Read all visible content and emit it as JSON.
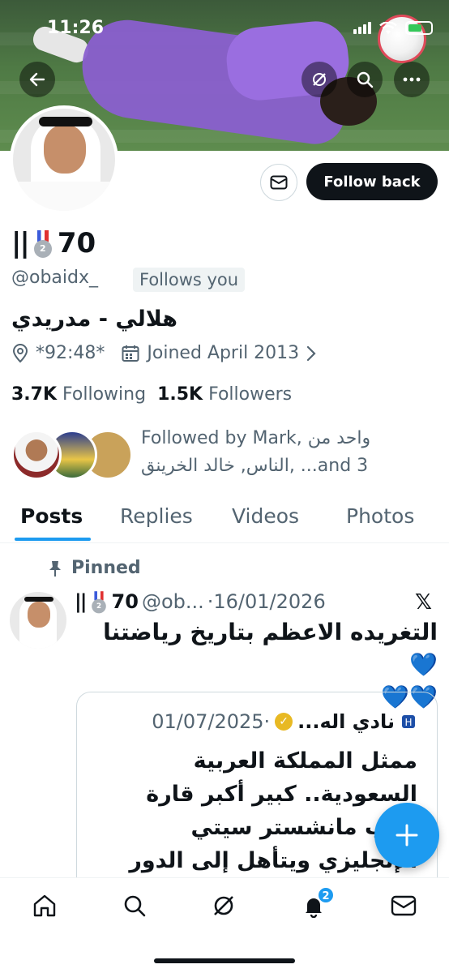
{
  "status_bar": {
    "time": "11:26"
  },
  "profile": {
    "display_name": "70",
    "handle": "@obaidx_",
    "follows_you": "Follows you",
    "bio": "هلالي - مدريدي",
    "location": "*92:48*",
    "joined": "Joined April 2013",
    "following_count": "3.7K",
    "following_label": "Following",
    "followers_count": "1.5K",
    "followers_label": "Followers",
    "followed_by_line1": "Followed by Mark, واحد من",
    "followed_by_line2": "الناس, خالد الخرينق, ...and 3"
  },
  "actions": {
    "follow_back": "Follow back"
  },
  "tabs": [
    {
      "label": "Posts",
      "active": true
    },
    {
      "label": "Replies",
      "active": false
    },
    {
      "label": "Videos",
      "active": false
    },
    {
      "label": "Photos",
      "active": false
    }
  ],
  "post": {
    "pinned_label": "Pinned",
    "author_name": "70",
    "author_handle": "@ob...",
    "date": "·16/01/2026",
    "text_line1": "التغريده الاعظم بتاريخ رياضتنا 💙",
    "text_line2": "💙💙",
    "quote": {
      "author_name": "نادي اله...",
      "date": "·01/07/2025",
      "text": "ممثل المملكة العربية السعودية.. كبير أكبر قارة يغلب مانشستر سيتي الإنجليزي ويتأهل إلى الدور ربع النهائي من كأس العالم"
    }
  },
  "bottom_nav": {
    "notifications_badge": "2"
  },
  "colors": {
    "accent": "#1d9bf0",
    "text": "#0f1419",
    "secondary": "#536471"
  }
}
